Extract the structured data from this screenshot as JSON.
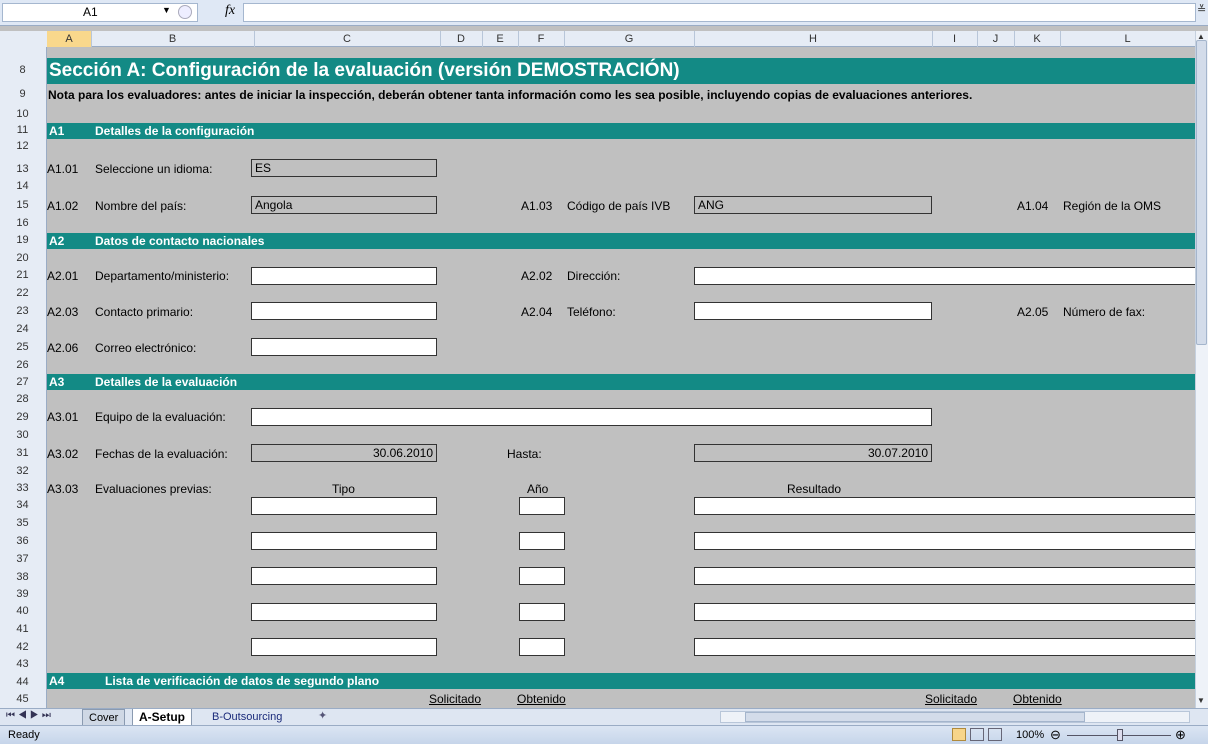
{
  "formula_bar": {
    "cell_ref": "A1",
    "fx": "fx",
    "content": ""
  },
  "columns": [
    "A",
    "B",
    "C",
    "D",
    "E",
    "F",
    "G",
    "H",
    "I",
    "J",
    "K",
    "L"
  ],
  "rows": [
    "8",
    "9",
    "10",
    "11",
    "12",
    "13",
    "14",
    "15",
    "16",
    "19",
    "20",
    "21",
    "22",
    "23",
    "24",
    "25",
    "26",
    "27",
    "28",
    "29",
    "30",
    "31",
    "32",
    "33",
    "34",
    "35",
    "36",
    "37",
    "38",
    "39",
    "40",
    "41",
    "42",
    "43",
    "44",
    "45"
  ],
  "sheet": {
    "title": "Sección A: Configuración de la evaluación (versión DEMOSTRACIÓN)",
    "note": "Nota para los evaluadores: antes de iniciar la inspección, deberán obtener tanta información como les sea posible, incluyendo copias de evaluaciones anteriores.",
    "a1": {
      "code": "A1",
      "heading": "Detalles de la configuración",
      "r13": {
        "code": "A1.01",
        "label": "Seleccione un idioma:",
        "value": "ES"
      },
      "r15": {
        "code": "A1.02",
        "label": "Nombre del país:",
        "value": "Angola",
        "code2": "A1.03",
        "label2": "Código de país IVB",
        "value2": "ANG",
        "code3": "A1.04",
        "label3": "Región de la OMS"
      }
    },
    "a2": {
      "code": "A2",
      "heading": "Datos de contacto nacionales",
      "r21": {
        "code": "A2.01",
        "label": "Departamento/ministerio:",
        "code2": "A2.02",
        "label2": "Dirección:"
      },
      "r23": {
        "code": "A2.03",
        "label": "Contacto primario:",
        "code2": "A2.04",
        "label2": "Teléfono:",
        "code3": "A2.05",
        "label3": "Número de fax:"
      },
      "r25": {
        "code": "A2.06",
        "label": "Correo electrónico:"
      }
    },
    "a3": {
      "code": "A3",
      "heading": "Detalles de la evaluación",
      "r29": {
        "code": "A3.01",
        "label": "Equipo de la evaluación:"
      },
      "r31": {
        "code": "A3.02",
        "label": "Fechas de la evaluación:",
        "value": "30.06.2010",
        "label2": "Hasta:",
        "value2": "30.07.2010"
      },
      "r33": {
        "code": "A3.03",
        "label": "Evaluaciones previas:",
        "col_tipo": "Tipo",
        "col_anio": "Año",
        "col_resultado": "Resultado"
      }
    },
    "a4": {
      "code": "A4",
      "heading": "Lista de verificación de datos de segundo plano",
      "solicitado": "Solicitado",
      "obtenido": "Obtenido"
    }
  },
  "tabs": [
    "Cover",
    "A-Setup",
    "B-Outsourcing"
  ],
  "active_tab": "A-Setup",
  "status": {
    "ready": "Ready",
    "zoom": "100%"
  }
}
